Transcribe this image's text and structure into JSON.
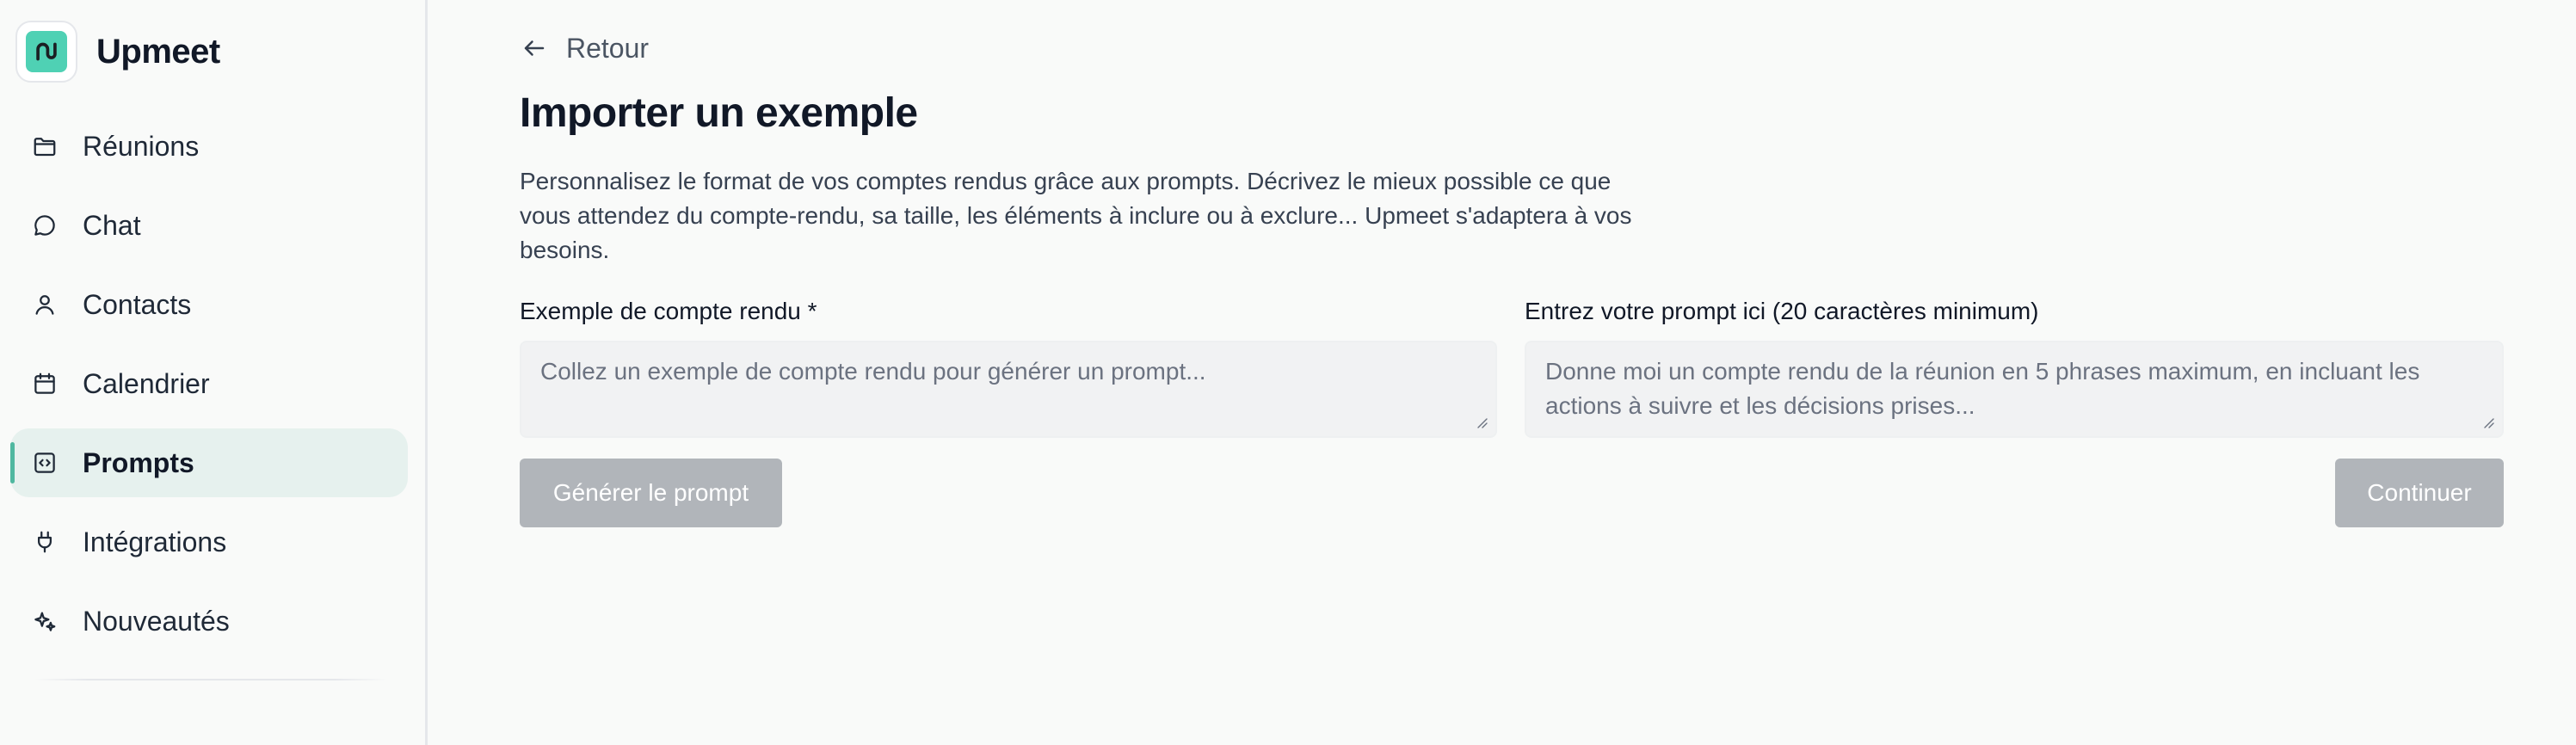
{
  "brand": {
    "name": "Upmeet",
    "logo_icon": "upmeet-logo-icon",
    "accent_color": "#4fd1b4"
  },
  "sidebar": {
    "items": [
      {
        "label": "Réunions",
        "icon": "folder-icon",
        "active": false
      },
      {
        "label": "Chat",
        "icon": "chat-bubble-icon",
        "active": false
      },
      {
        "label": "Contacts",
        "icon": "user-icon",
        "active": false
      },
      {
        "label": "Calendrier",
        "icon": "calendar-icon",
        "active": false
      },
      {
        "label": "Prompts",
        "icon": "code-square-icon",
        "active": true
      },
      {
        "label": "Intégrations",
        "icon": "plug-icon",
        "active": false
      },
      {
        "label": "Nouveautés",
        "icon": "sparkles-icon",
        "active": false
      }
    ]
  },
  "main": {
    "back_label": "Retour",
    "title": "Importer un exemple",
    "description": "Personnalisez le format de vos comptes rendus grâce aux prompts. Décrivez le mieux possible ce que vous attendez du compte-rendu, sa taille, les éléments à inclure ou à exclure... Upmeet s'adaptera à vos besoins.",
    "example_field": {
      "label": "Exemple de compte rendu *",
      "placeholder": "Collez un exemple de compte rendu pour générer un prompt...",
      "value": ""
    },
    "prompt_field": {
      "label": "Entrez votre prompt ici (20 caractères minimum)",
      "placeholder": "Donne moi un compte rendu de la réunion en 5 phrases maximum, en incluant les actions à suivre et les décisions prises...",
      "value": ""
    },
    "generate_button_label": "Générer le prompt",
    "continue_button_label": "Continuer",
    "disabled_button_color": "#b1b5ba"
  }
}
